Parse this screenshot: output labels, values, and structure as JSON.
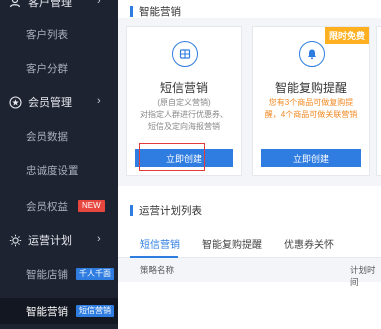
{
  "sidebar": {
    "customer_mgmt": "客户管理",
    "customer_list": "客户列表",
    "customer_group": "客户分群",
    "member_mgmt": "会员管理",
    "member_data": "会员数据",
    "loyalty": "忠诚度设置",
    "member_rights": "会员权益",
    "member_rights_tag": "NEW",
    "ops_plan": "运营计划",
    "smart_store": "智能店铺",
    "smart_store_tag": "千人千面",
    "smart_marketing": "智能营销",
    "smart_marketing_tag": "短信营销"
  },
  "main": {
    "section_smart": "智能营销",
    "cards": [
      {
        "title": "短信营销",
        "desc1": "(原自定义营销)",
        "desc2": "对指定人群进行优惠券、",
        "desc3": "短信及定向海报营销",
        "button": "立即创建"
      },
      {
        "title": "智能复购提醒",
        "desc1": "您有3个商品可做复购提",
        "desc2": "醒，4个商品可做关联营销",
        "button": "立即创建",
        "badge": "限时免费"
      }
    ],
    "section_plan": "运营计划列表",
    "tabs": [
      "短信营销",
      "智能复购提醒",
      "优惠券关怀"
    ],
    "table_headers": [
      "策略名称",
      "计划时间"
    ]
  },
  "colors": {
    "accent": "#2f7de1",
    "sidebar": "#1e2331",
    "highlight": "#e23b3b",
    "orange": "#f08a24"
  }
}
